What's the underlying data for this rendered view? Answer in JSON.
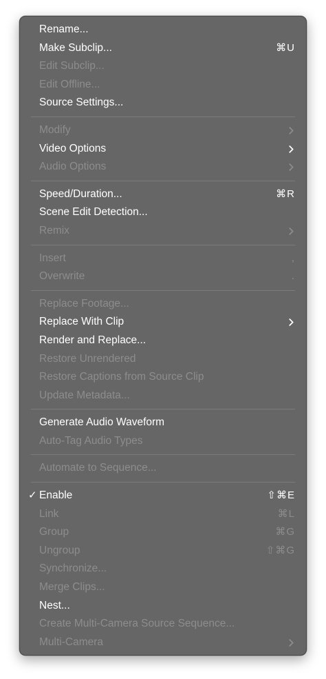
{
  "menu": {
    "groups": [
      {
        "items": [
          {
            "label": "Rename...",
            "enabled": true,
            "shortcut": "",
            "submenu": false
          },
          {
            "label": "Make Subclip...",
            "enabled": true,
            "shortcut": "⌘U",
            "submenu": false
          },
          {
            "label": "Edit Subclip...",
            "enabled": false,
            "shortcut": "",
            "submenu": false
          },
          {
            "label": "Edit Offline...",
            "enabled": false,
            "shortcut": "",
            "submenu": false
          },
          {
            "label": "Source Settings...",
            "enabled": true,
            "shortcut": "",
            "submenu": false
          }
        ]
      },
      {
        "items": [
          {
            "label": "Modify",
            "enabled": false,
            "shortcut": "",
            "submenu": true
          },
          {
            "label": "Video Options",
            "enabled": true,
            "shortcut": "",
            "submenu": true
          },
          {
            "label": "Audio Options",
            "enabled": false,
            "shortcut": "",
            "submenu": true
          }
        ]
      },
      {
        "items": [
          {
            "label": "Speed/Duration...",
            "enabled": true,
            "shortcut": "⌘R",
            "submenu": false
          },
          {
            "label": "Scene Edit Detection...",
            "enabled": true,
            "shortcut": "",
            "submenu": false
          },
          {
            "label": "Remix",
            "enabled": false,
            "shortcut": "",
            "submenu": true
          }
        ]
      },
      {
        "items": [
          {
            "label": "Insert",
            "enabled": false,
            "shortcut": ",",
            "submenu": false
          },
          {
            "label": "Overwrite",
            "enabled": false,
            "shortcut": ".",
            "submenu": false
          }
        ]
      },
      {
        "items": [
          {
            "label": "Replace Footage...",
            "enabled": false,
            "shortcut": "",
            "submenu": false
          },
          {
            "label": "Replace With Clip",
            "enabled": true,
            "shortcut": "",
            "submenu": true
          },
          {
            "label": "Render and Replace...",
            "enabled": true,
            "shortcut": "",
            "submenu": false
          },
          {
            "label": "Restore Unrendered",
            "enabled": false,
            "shortcut": "",
            "submenu": false
          },
          {
            "label": "Restore Captions from Source Clip",
            "enabled": false,
            "shortcut": "",
            "submenu": false
          },
          {
            "label": "Update Metadata...",
            "enabled": false,
            "shortcut": "",
            "submenu": false
          }
        ]
      },
      {
        "items": [
          {
            "label": "Generate Audio Waveform",
            "enabled": true,
            "shortcut": "",
            "submenu": false
          },
          {
            "label": "Auto-Tag Audio Types",
            "enabled": false,
            "shortcut": "",
            "submenu": false
          }
        ]
      },
      {
        "items": [
          {
            "label": "Automate to Sequence...",
            "enabled": false,
            "shortcut": "",
            "submenu": false
          }
        ]
      },
      {
        "items": [
          {
            "label": "Enable",
            "enabled": true,
            "checked": true,
            "check_mark": "✓",
            "shortcut": "⇧⌘E",
            "submenu": false
          },
          {
            "label": "Link",
            "enabled": false,
            "shortcut": "⌘L",
            "submenu": false
          },
          {
            "label": "Group",
            "enabled": false,
            "shortcut": "⌘G",
            "submenu": false
          },
          {
            "label": "Ungroup",
            "enabled": false,
            "shortcut": "⇧⌘G",
            "submenu": false
          },
          {
            "label": "Synchronize...",
            "enabled": false,
            "shortcut": "",
            "submenu": false
          },
          {
            "label": "Merge Clips...",
            "enabled": false,
            "shortcut": "",
            "submenu": false
          },
          {
            "label": "Nest...",
            "enabled": true,
            "shortcut": "",
            "submenu": false
          },
          {
            "label": "Create Multi-Camera Source Sequence...",
            "enabled": false,
            "shortcut": "",
            "submenu": false
          },
          {
            "label": "Multi-Camera",
            "enabled": false,
            "shortcut": "",
            "submenu": true
          }
        ]
      }
    ]
  },
  "colors": {
    "menu_background": "#666666",
    "enabled_text": "#ffffff",
    "disabled_text": "#8d8d8d",
    "separator": "#7c7c7c"
  },
  "icons": {
    "submenu": "chevron-right-icon",
    "checked": "checkmark-icon"
  }
}
